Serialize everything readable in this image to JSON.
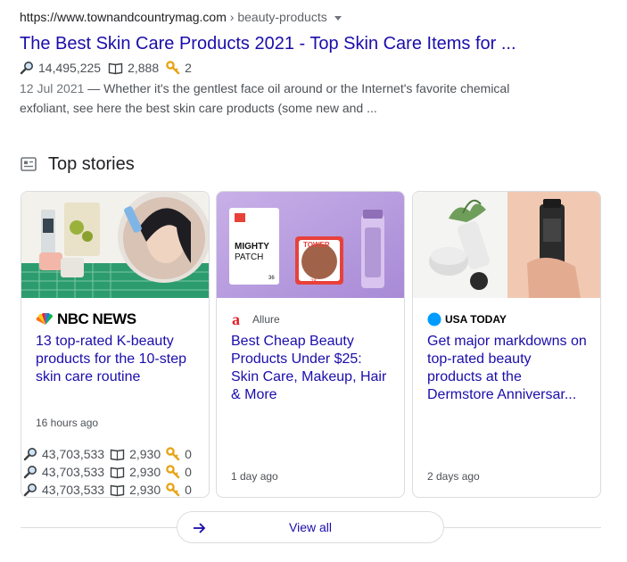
{
  "result": {
    "url": "https://www.townandcountrymag.com",
    "breadcrumb": " › beauty-products",
    "title": "The Best Skin Care Products 2021 - Top Skin Care Items for ...",
    "stats": {
      "views": "14,495,225",
      "pages": "2,888",
      "keys": "2"
    },
    "date": "12 Jul 2021",
    "snippet": " — Whether it's the gentlest face oil around or the Internet's favorite chemical exfoliant, see here the best skin care products (some new and ..."
  },
  "top_stories": {
    "title": "Top stories",
    "cards": [
      {
        "source": "NBC NEWS",
        "headline": "13 top-rated K-beauty products for the 10-step skin care routine",
        "age": "16 hours ago",
        "stats": [
          {
            "views": "43,703,533",
            "pages": "2,930",
            "keys": "0"
          },
          {
            "views": "43,703,533",
            "pages": "2,930",
            "keys": "0"
          },
          {
            "views": "43,703,533",
            "pages": "2,930",
            "keys": "0"
          }
        ]
      },
      {
        "source": "Allure",
        "headline": "Best Cheap Beauty Products Under $25: Skin Care, Makeup, Hair & More",
        "age": "1 day ago",
        "thumb_text": {
          "mighty": "MIGHTY",
          "patch": "PATCH",
          "num": "36",
          "brand": "TOWER",
          "sub": "28"
        }
      },
      {
        "source": "USA TODAY",
        "headline": "Get major markdowns on top-rated beauty products at the Dermstore Anniversar...",
        "age": "2 days ago"
      }
    ],
    "view_all": "View all"
  },
  "colors": {
    "link": "#1a0dab",
    "meta": "#4d5156",
    "border": "#dadce0",
    "key_icon": "#e8a317",
    "usa_today_blue": "#009bff",
    "allure_red": "#e41e26"
  }
}
